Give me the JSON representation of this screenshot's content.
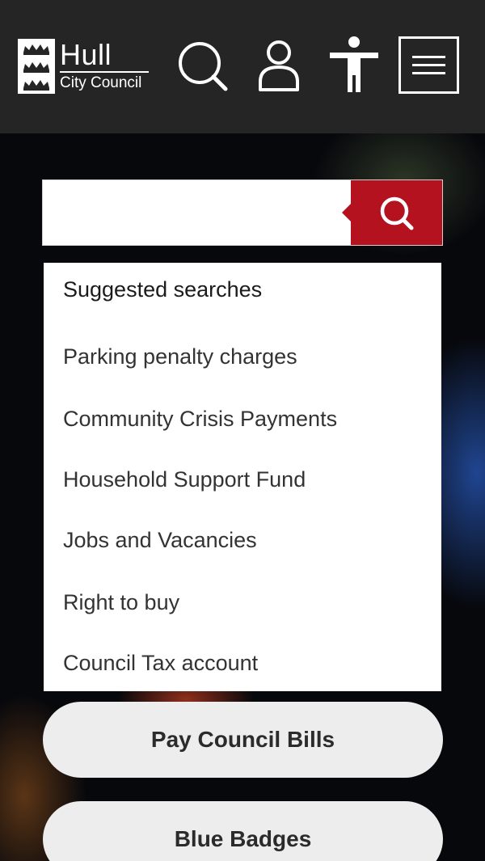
{
  "header": {
    "logo_primary": "Hull",
    "logo_secondary": "City Council",
    "icons": [
      "crest-icon",
      "search-icon",
      "account-icon",
      "accessibility-icon",
      "menu-icon"
    ]
  },
  "search": {
    "value": "",
    "placeholder": "",
    "submit_icon": "search-icon",
    "accent_color": "#b3121e"
  },
  "suggestions": {
    "heading": "Suggested searches",
    "items": [
      "Parking penalty charges",
      "Community Crisis Payments",
      "Household Support Fund",
      "Jobs and Vacancies",
      "Right to buy",
      "Council Tax account"
    ]
  },
  "quick_links": [
    "Pay Council Bills",
    "Blue Badges"
  ],
  "colors": {
    "header_bg": "#252525",
    "accent": "#b3121e",
    "pill_bg": "#ededed"
  }
}
